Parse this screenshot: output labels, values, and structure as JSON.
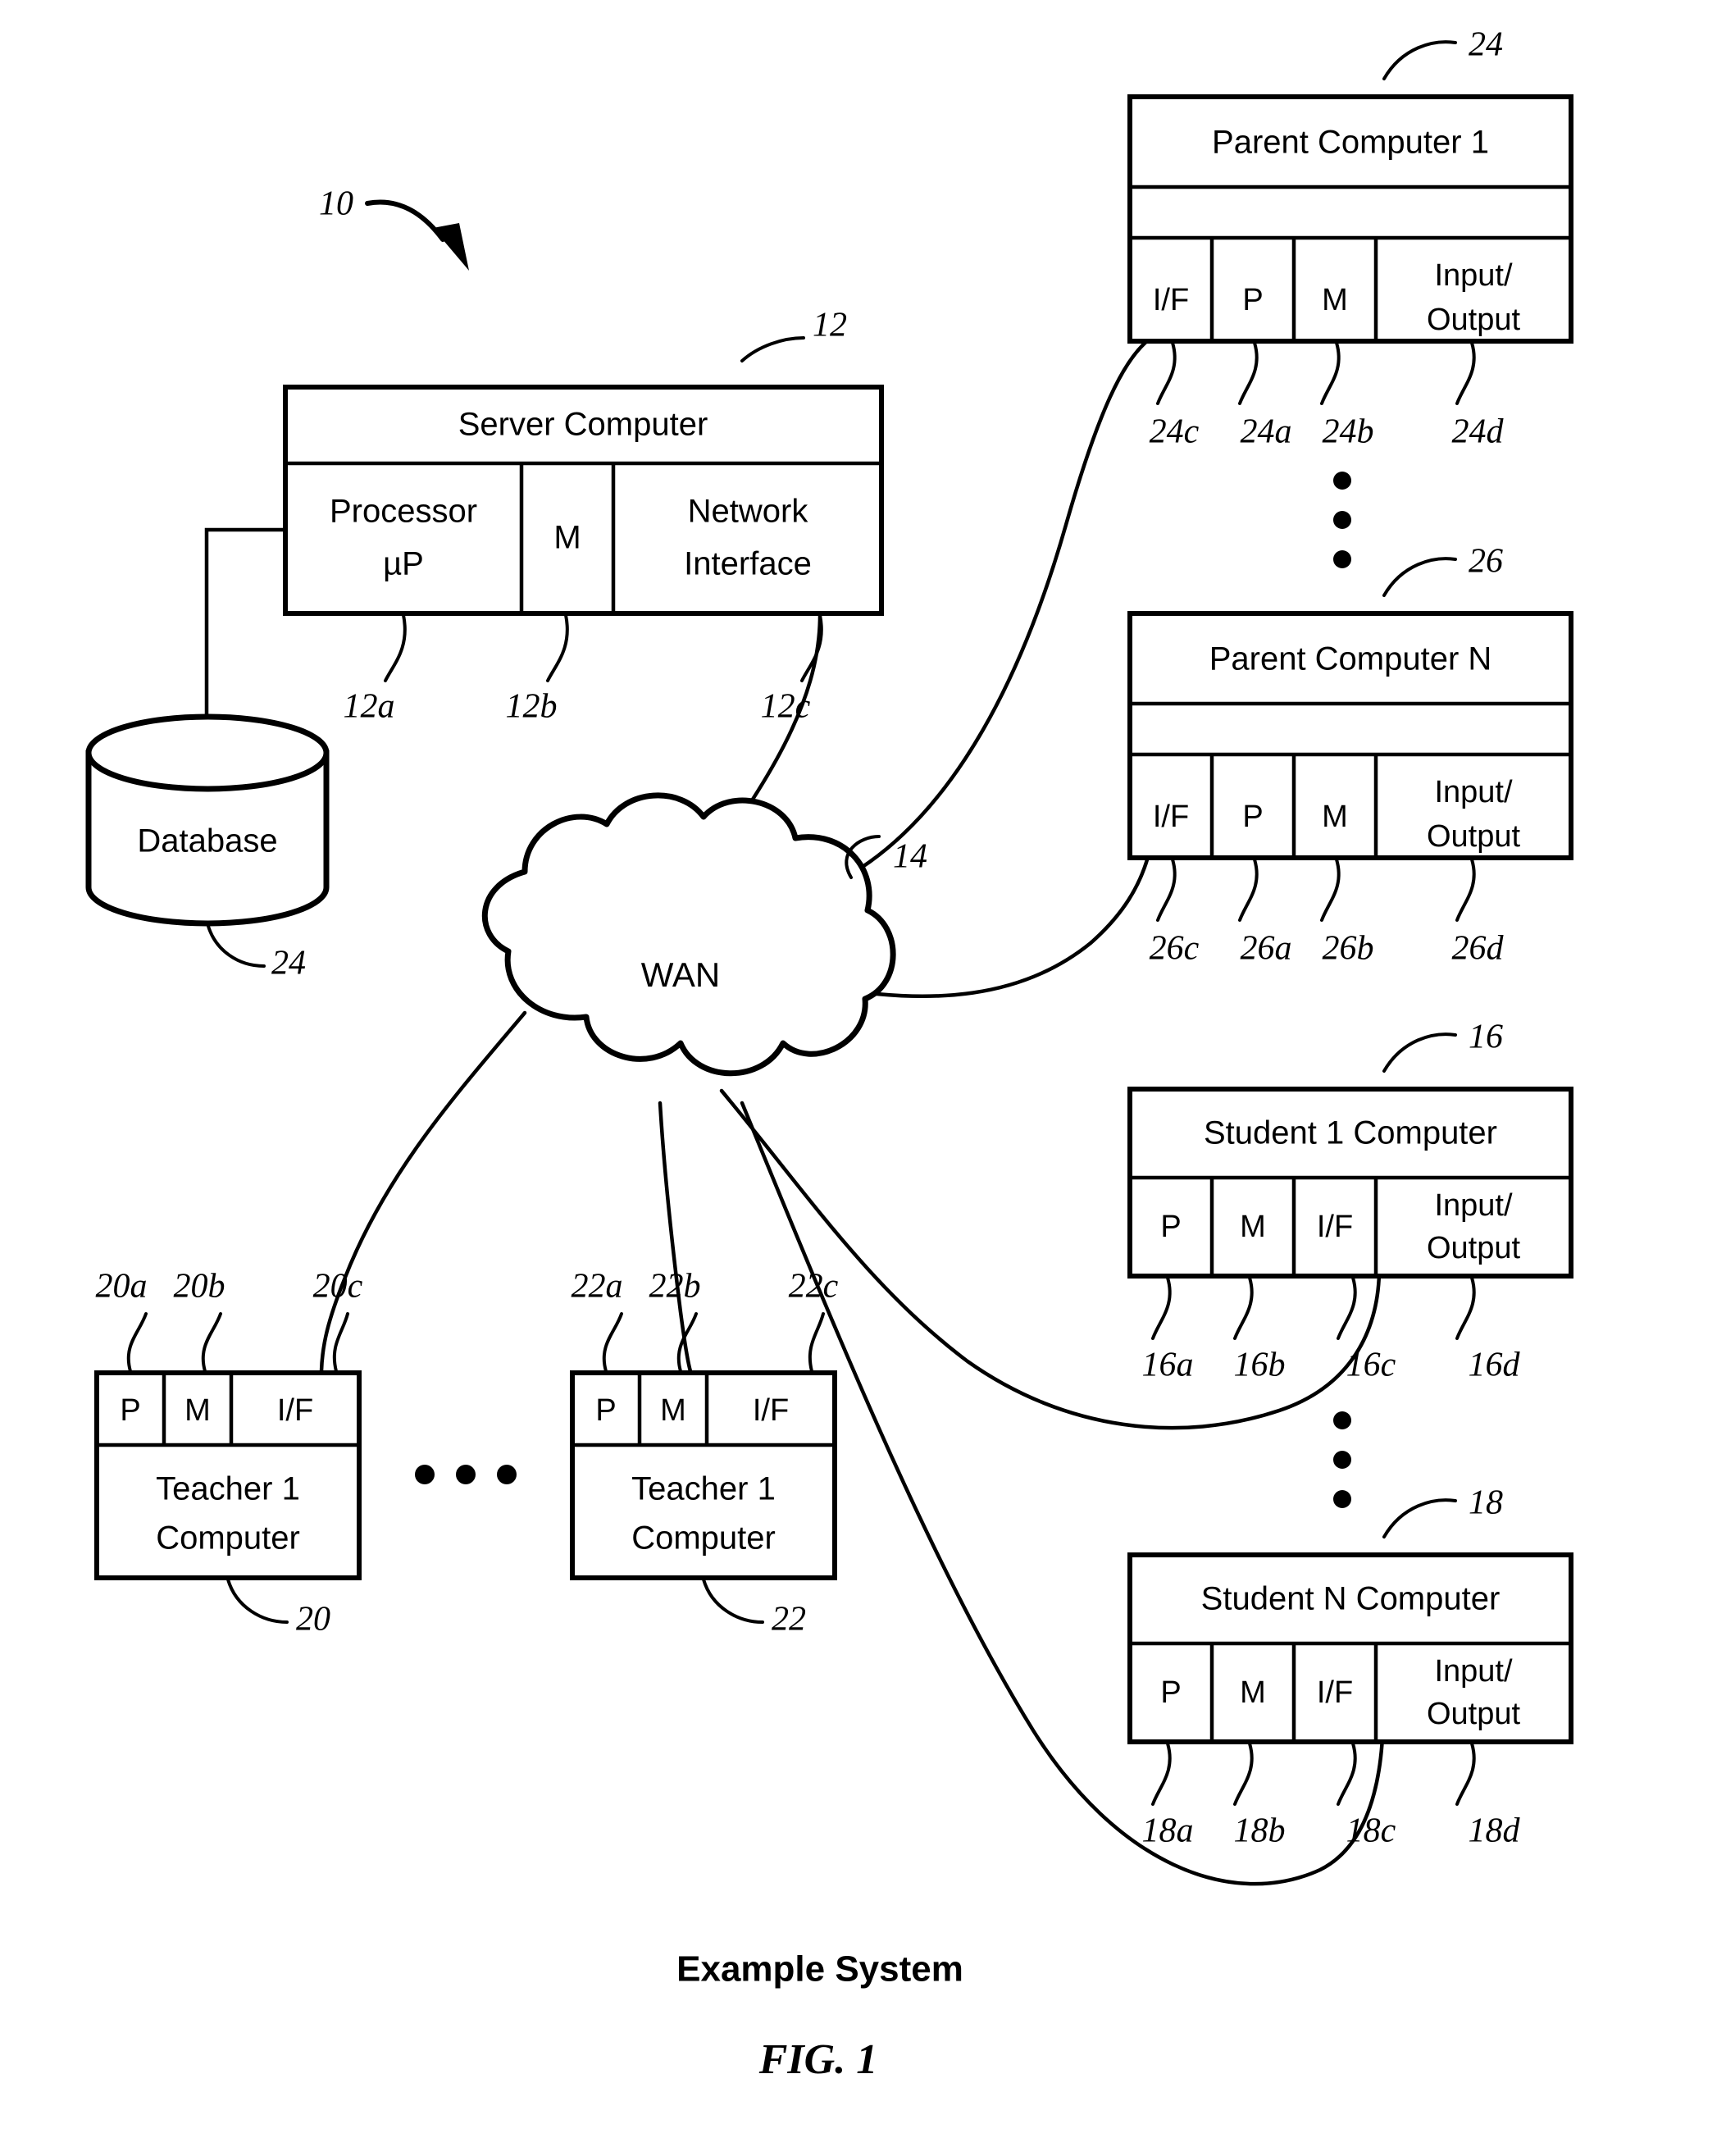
{
  "figure": {
    "caption": "Example System",
    "label": "FIG. 1",
    "system_ref": "10"
  },
  "nodes": {
    "server": {
      "title": "Server Computer",
      "ref": "12",
      "cells": [
        {
          "label": "Processor",
          "label2": "µP",
          "ref": "12a"
        },
        {
          "label": "M",
          "ref": "12b"
        },
        {
          "label": "Network",
          "label2": "Interface",
          "ref": "12c"
        }
      ]
    },
    "database": {
      "title": "Database",
      "ref": "24"
    },
    "wan": {
      "title": "WAN",
      "ref": "14"
    },
    "parent1": {
      "title": "Parent Computer 1",
      "ref": "24",
      "cells": [
        {
          "label": "I/F",
          "ref": "24c"
        },
        {
          "label": "P",
          "ref": "24a"
        },
        {
          "label": "M",
          "ref": "24b"
        },
        {
          "label": "Input/",
          "label2": "Output",
          "ref": "24d"
        }
      ]
    },
    "parentN": {
      "title": "Parent Computer N",
      "ref": "26",
      "cells": [
        {
          "label": "I/F",
          "ref": "26c"
        },
        {
          "label": "P",
          "ref": "26a"
        },
        {
          "label": "M",
          "ref": "26b"
        },
        {
          "label": "Input/",
          "label2": "Output",
          "ref": "26d"
        }
      ]
    },
    "student1": {
      "title": "Student 1 Computer",
      "ref": "16",
      "cells": [
        {
          "label": "P",
          "ref": "16a"
        },
        {
          "label": "M",
          "ref": "16b"
        },
        {
          "label": "I/F",
          "ref": "16c"
        },
        {
          "label": "Input/",
          "label2": "Output",
          "ref": "16d"
        }
      ]
    },
    "studentN": {
      "title": "Student N Computer",
      "ref": "18",
      "cells": [
        {
          "label": "P",
          "ref": "18a"
        },
        {
          "label": "M",
          "ref": "18b"
        },
        {
          "label": "I/F",
          "ref": "18c"
        },
        {
          "label": "Input/",
          "label2": "Output",
          "ref": "18d"
        }
      ]
    },
    "teacher1": {
      "title1": "Teacher 1",
      "title2": "Computer",
      "ref": "20",
      "cells": [
        {
          "label": "P",
          "ref": "20a"
        },
        {
          "label": "M",
          "ref": "20b"
        },
        {
          "label": "I/F",
          "ref": "20c"
        }
      ]
    },
    "teacher2": {
      "title1": "Teacher 1",
      "title2": "Computer",
      "ref": "22",
      "cells": [
        {
          "label": "P",
          "ref": "22a"
        },
        {
          "label": "M",
          "ref": "22b"
        },
        {
          "label": "I/F",
          "ref": "22c"
        }
      ]
    }
  },
  "colors": {
    "ink": "#000000",
    "paper": "#ffffff"
  }
}
